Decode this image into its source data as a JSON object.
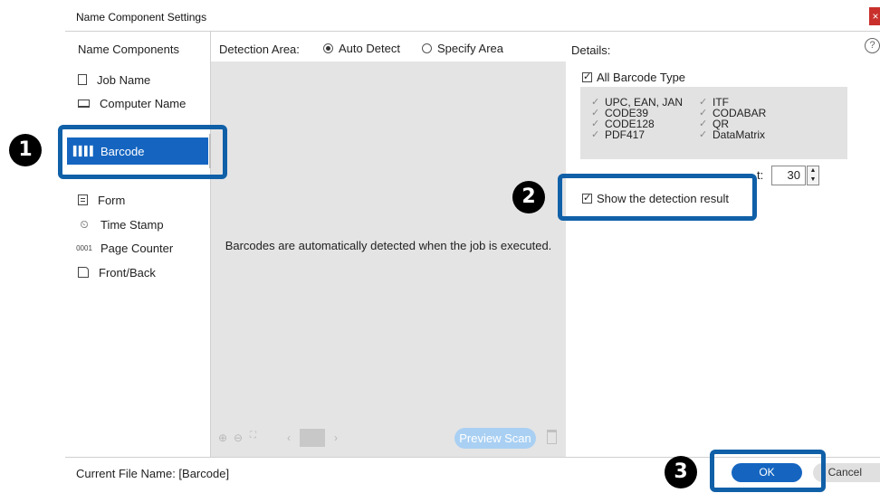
{
  "window": {
    "title": "Name Component Settings",
    "close_glyph": "×"
  },
  "left": {
    "header": "Name Components",
    "items": [
      {
        "label": "Job Name",
        "icon": "document-icon"
      },
      {
        "label": "Computer Name",
        "icon": "laptop-icon"
      },
      {
        "label": "Barcode",
        "icon": "barcode-icon",
        "selected": true
      },
      {
        "label": "Form",
        "icon": "form-icon"
      },
      {
        "label": "Time Stamp",
        "icon": "clock-icon"
      },
      {
        "label": "Page Counter",
        "icon": "counter-icon",
        "glyph": "0001"
      },
      {
        "label": "Front/Back",
        "icon": "page-icon"
      }
    ]
  },
  "center": {
    "detection_area_label": "Detection Area:",
    "radios": [
      {
        "label": "Auto Detect",
        "checked": true
      },
      {
        "label": "Specify Area",
        "checked": false
      }
    ],
    "preview_message": "Barcodes are automatically detected when the job is executed.",
    "preview_scan_label": "Preview Scan"
  },
  "details": {
    "label": "Details:",
    "help_glyph": "?",
    "all_barcode_type": {
      "label": "All Barcode Type",
      "checked": true
    },
    "barcode_types_col1": [
      "UPC, EAN, JAN",
      "CODE39",
      "CODE128",
      "PDF417"
    ],
    "barcode_types_col2": [
      "ITF",
      "CODABAR",
      "QR",
      "DataMatrix"
    ],
    "count_label_fragment": "t:",
    "count_value": "30",
    "show_detection": {
      "label": "Show the detection result",
      "checked": true
    }
  },
  "footer": {
    "current_file": "Current File Name: [Barcode]",
    "ok_label": "OK",
    "cancel_label": "Cancel"
  },
  "callouts": [
    "1",
    "2",
    "3"
  ],
  "colors": {
    "accent": "#1565c0",
    "callout": "#1060a8",
    "preview_bg": "#e4e4e4"
  }
}
